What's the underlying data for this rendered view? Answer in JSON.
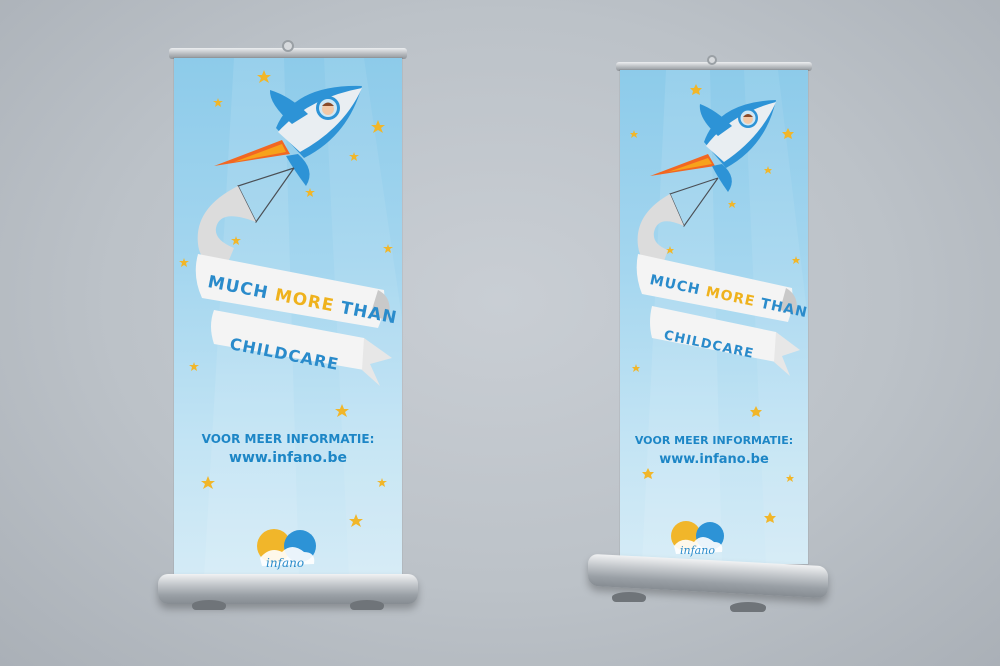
{
  "banners": [
    {
      "headline_prefix": "MUCH ",
      "headline_accent": "MORE",
      "headline_suffix": " THAN",
      "headline_line2": "CHILDCARE",
      "info_label": "VOOR MEER INFORMATIE:",
      "info_url": "www.infano.be",
      "brand": "infano"
    },
    {
      "headline_prefix": "MUCH ",
      "headline_accent": "MORE",
      "headline_suffix": " THAN",
      "headline_line2": "CHILDCARE",
      "info_label": "VOOR MEER INFORMATIE:",
      "info_url": "www.infano.be",
      "brand": "infano"
    }
  ],
  "colors": {
    "sky_light": "#d4ebf6",
    "sky_dark": "#8dcbea",
    "text_blue": "#2a8bcb",
    "accent_yellow": "#efb21d",
    "rocket_blue": "#2d93d6",
    "flame_orange": "#f26722"
  }
}
